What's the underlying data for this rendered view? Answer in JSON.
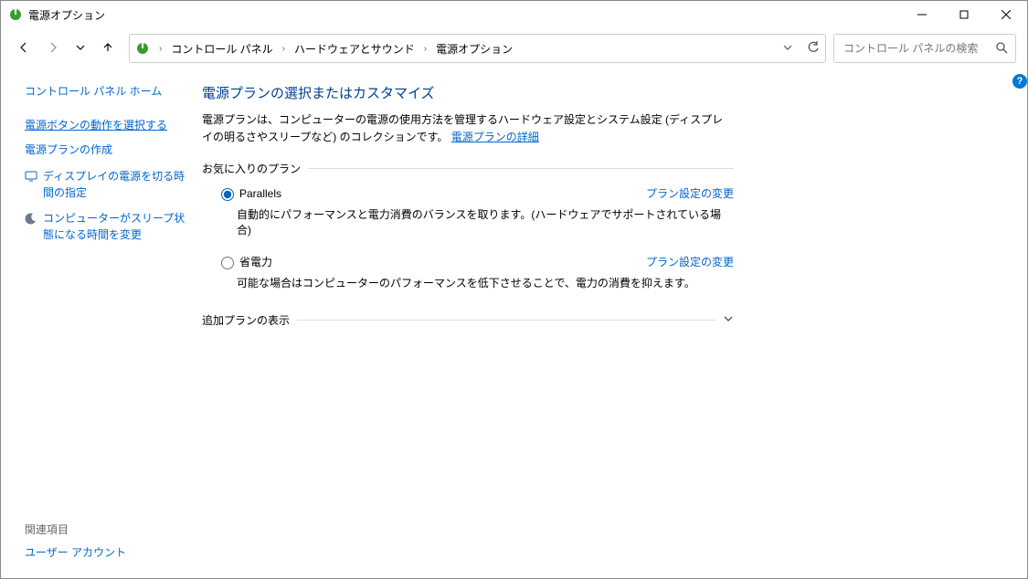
{
  "window": {
    "title": "電源オプション"
  },
  "breadcrumbs": {
    "a": "コントロール パネル",
    "b": "ハードウェアとサウンド",
    "c": "電源オプション"
  },
  "search": {
    "placeholder": "コントロール パネルの検索"
  },
  "sidebar": {
    "home": "コントロール パネル ホーム",
    "l1": "電源ボタンの動作を選択する",
    "l2": "電源プランの作成",
    "l3": "ディスプレイの電源を切る時間の指定",
    "l4": "コンピューターがスリープ状態になる時間を変更",
    "footer_head": "関連項目",
    "footer_link": "ユーザー アカウント"
  },
  "main": {
    "title": "電源プランの選択またはカスタマイズ",
    "desc_pre": "電源プランは、コンピューターの電源の使用方法を管理するハードウェア設定とシステム設定 (ディスプレイの明るさやスリープなど) のコレクションです。",
    "desc_link": "電源プランの詳細",
    "fav_label": "お気に入りのプラン",
    "plans": [
      {
        "name": "Parallels",
        "desc": "自動的にパフォーマンスと電力消費のバランスを取ります。(ハードウェアでサポートされている場合)",
        "change": "プラン設定の変更",
        "selected": true
      },
      {
        "name": "省電力",
        "desc": "可能な場合はコンピューターのパフォーマンスを低下させることで、電力の消費を抑えます。",
        "change": "プラン設定の変更",
        "selected": false
      }
    ],
    "more_label": "追加プランの表示"
  },
  "help": "?"
}
